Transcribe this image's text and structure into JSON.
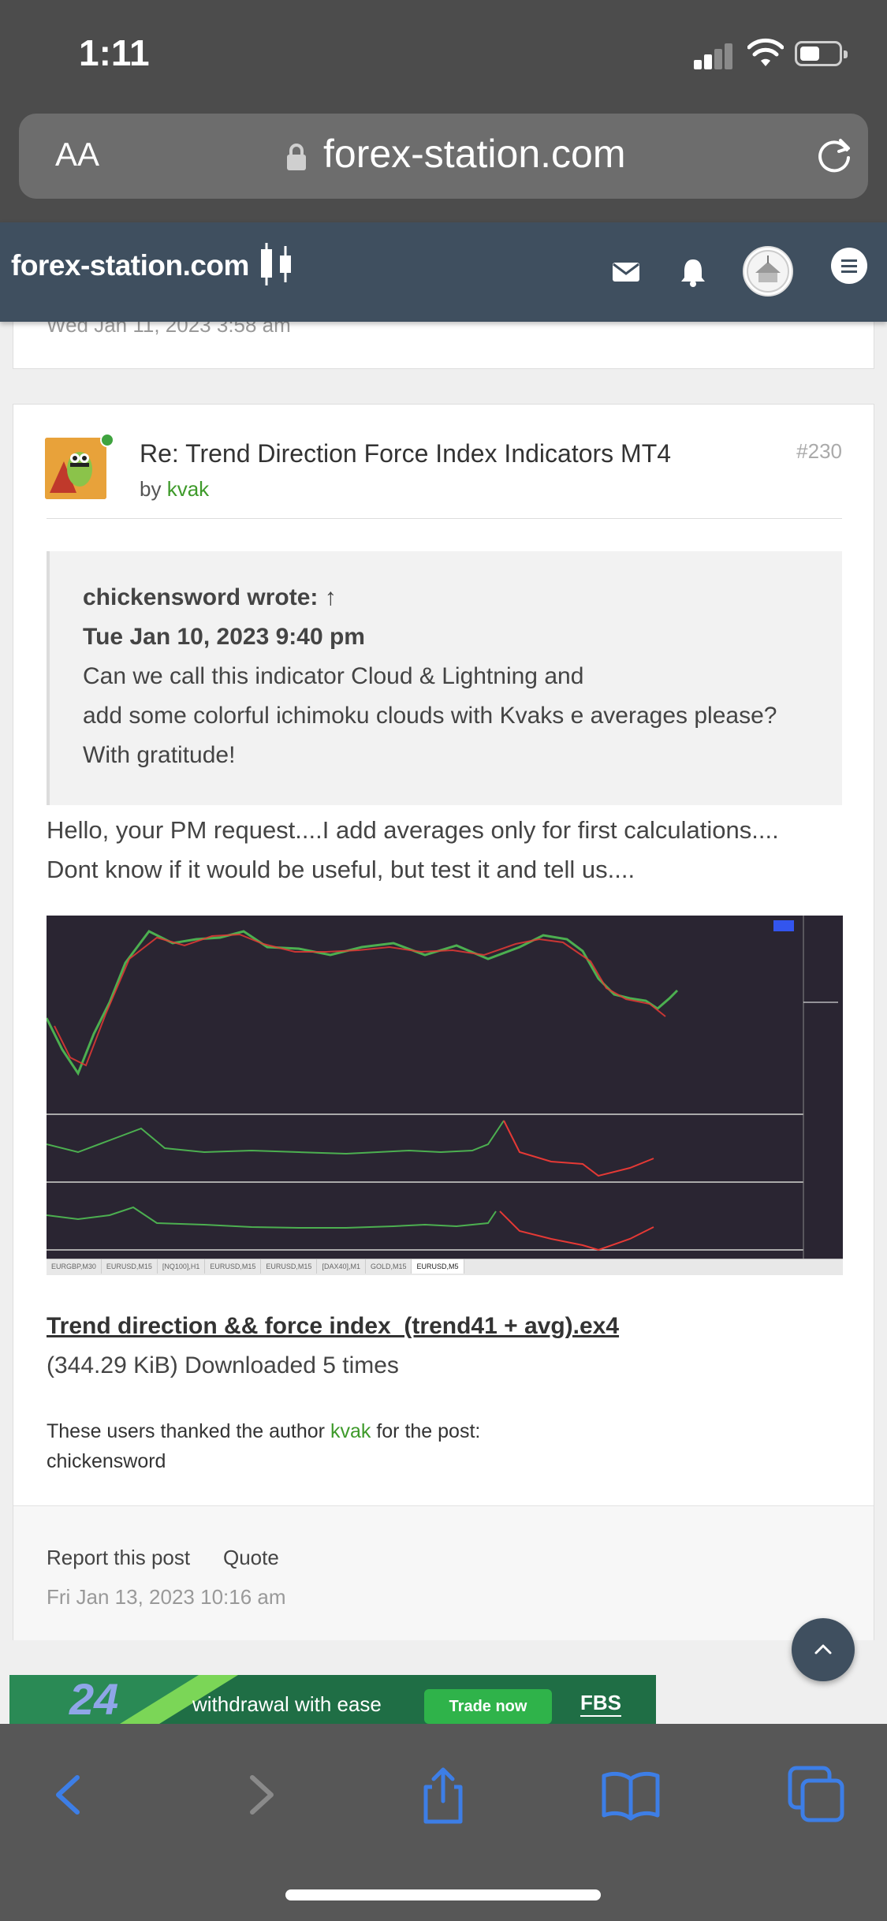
{
  "status_bar": {
    "time": "1:11"
  },
  "browser": {
    "aa_label": "AA",
    "url": "forex-station.com"
  },
  "site": {
    "logo": "forex-station.com"
  },
  "prev_post": {
    "date": "Wed Jan 11, 2023 3:58 am"
  },
  "post": {
    "title": "Re: Trend Direction Force Index Indicators MT4",
    "number": "#230",
    "by": "by",
    "author": "kvak",
    "quote": {
      "author": "chickensword wrote: ↑",
      "date": "Tue Jan 10, 2023 9:40 pm",
      "lines": [
        "Can we call this indicator Cloud & Lightning and",
        "add some colorful ichimoku clouds with Kvaks e averages please?",
        "With gratitude!"
      ]
    },
    "body_lines": [
      "Hello, your PM request....I add averages only for first calculations....",
      "Dont know if it would be useful, but test it and tell us...."
    ],
    "chart_tabs": [
      "EURGBP,M30",
      "EURUSD,M15",
      "[NQ100],H1",
      "EURUSD,M15",
      "EURUSD,M15",
      "[DAX40],M1",
      "GOLD,M15",
      "EURUSD,M5"
    ],
    "chart_active_tab": "EURUSD,M5",
    "attachment": {
      "name": "Trend direction && force index_(trend41 + avg).ex4",
      "info": "(344.29 KiB) Downloaded 5 times"
    },
    "thanks_prefix": "These users thanked the author",
    "thanks_author": "kvak",
    "thanks_suffix": "for the post:",
    "thanks_users": "chickensword",
    "actions": {
      "report": "Report this post",
      "quote": "Quote"
    },
    "date": "Fri Jan 13, 2023 10:16 am"
  },
  "ad": {
    "number": "24",
    "text": "withdrawal with ease",
    "button": "Trade now",
    "brand": "FBS"
  },
  "icons": {
    "lock": "lock-icon",
    "reload": "reload-icon",
    "mail": "mail-icon",
    "bell": "bell-icon",
    "menu": "menu-icon",
    "scroll_top": "chevron-up-icon"
  },
  "colors": {
    "header_bg": "#3f4f5f",
    "accent_green": "#3e9a2a",
    "toolbar_blue": "#3d7ee6"
  }
}
